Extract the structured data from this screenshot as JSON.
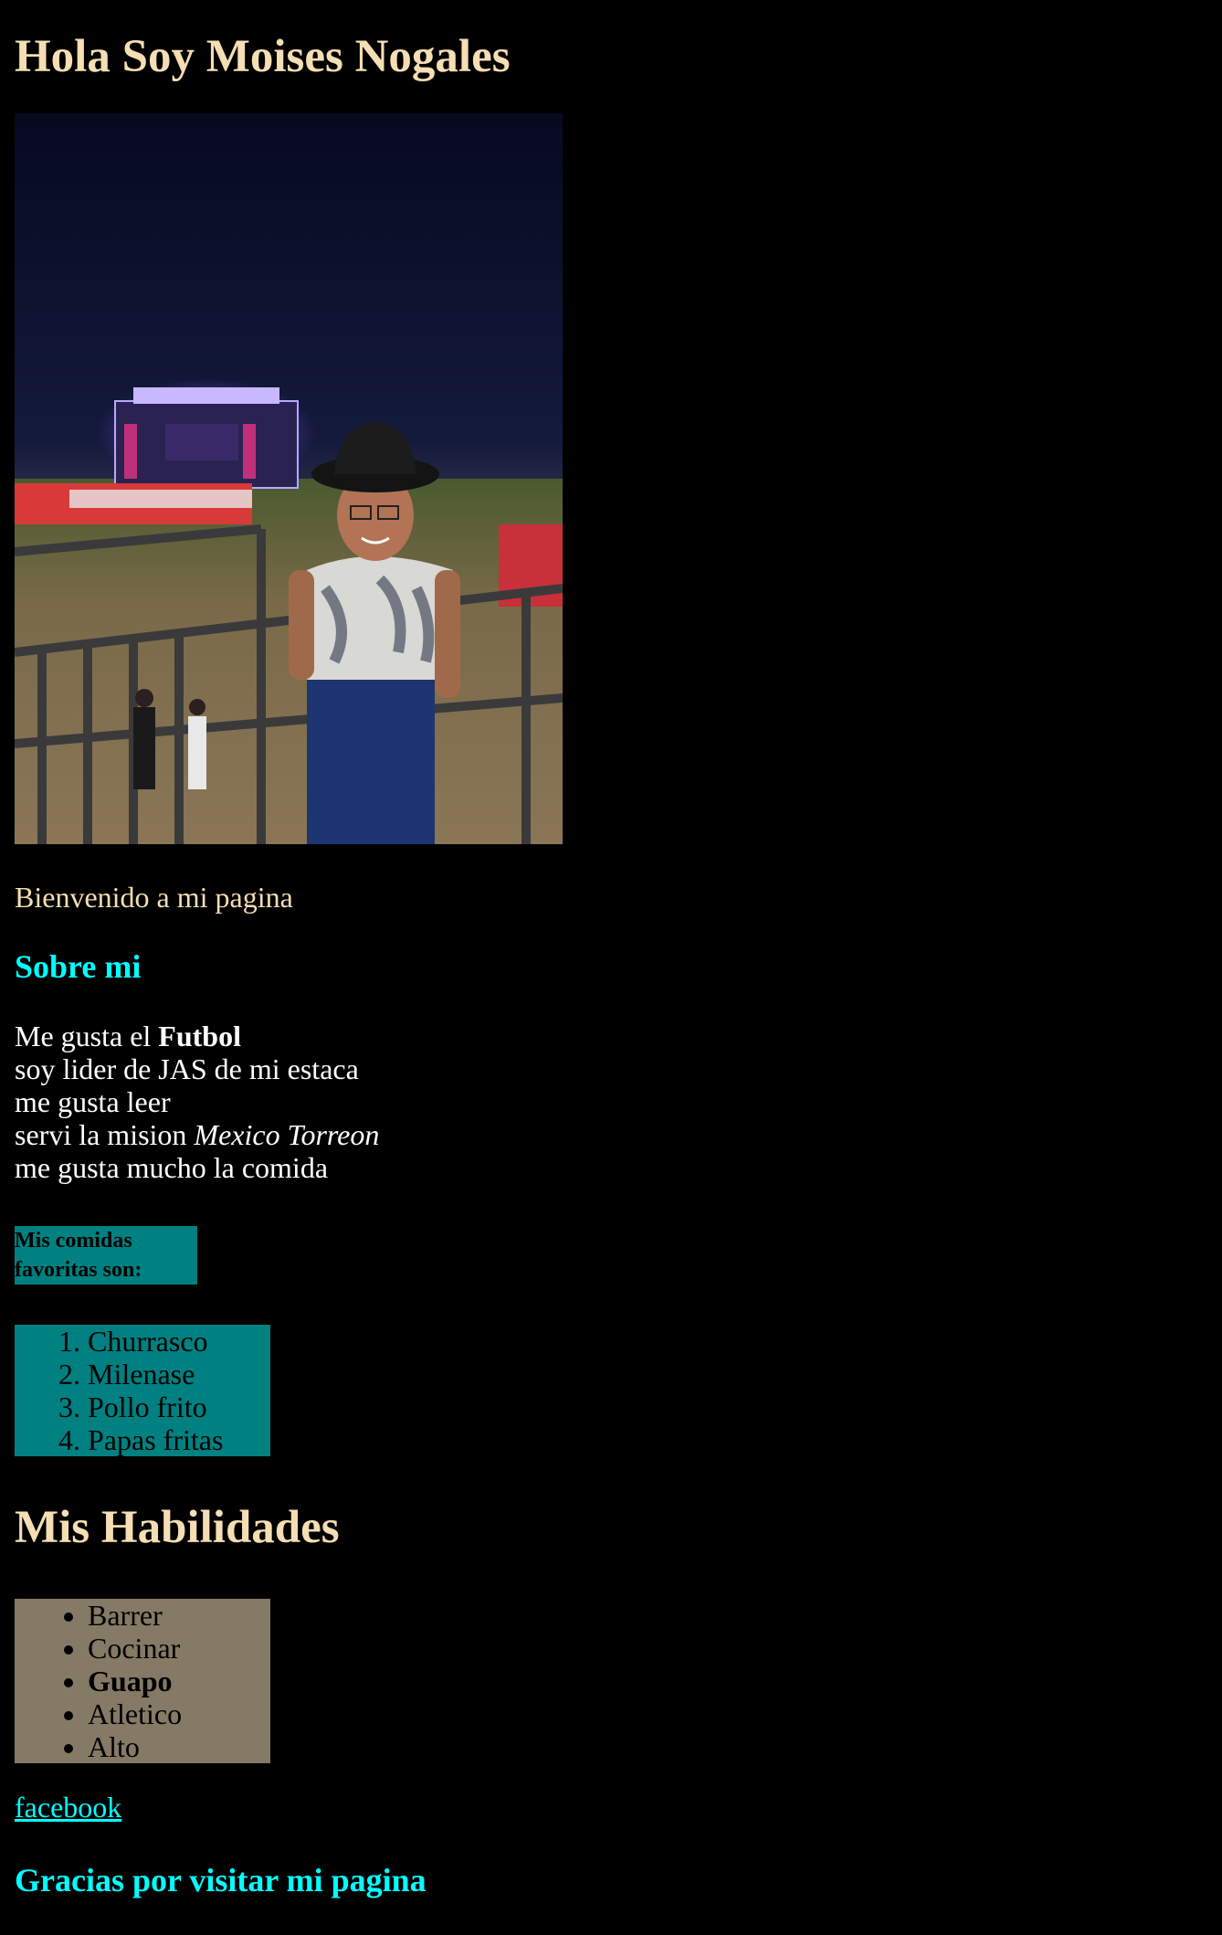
{
  "header": {
    "title": "Hola Soy Moises Nogales"
  },
  "welcome": {
    "text": "Bienvenido a mi pagina"
  },
  "about": {
    "heading": "Sobre mi",
    "line1_prefix": "Me gusta el ",
    "line1_bold": "Futbol",
    "line2": "soy lider de JAS de mi estaca",
    "line3": "me gusta leer",
    "line4_prefix": "servi la mision ",
    "line4_italic": "Mexico Torreon",
    "line5": "me gusta mucho la comida"
  },
  "foods": {
    "heading": "Mis comidas favoritas son:",
    "items": [
      "Churrasco",
      "Milenase",
      "Pollo frito",
      "Papas fritas"
    ]
  },
  "skills": {
    "heading": "Mis Habilidades",
    "items": [
      "Barrer",
      "Cocinar",
      "Guapo",
      "Atletico",
      "Alto"
    ]
  },
  "links": {
    "facebook_label": "facebook"
  },
  "footer": {
    "thanks": "Gracias por visitar mi pagina"
  },
  "colors": {
    "background": "#000000",
    "heading_wheat": "#f5deb3",
    "accent_cyan": "#00ffff",
    "foods_bg": "#008080",
    "skills_bg": "#857a65"
  }
}
